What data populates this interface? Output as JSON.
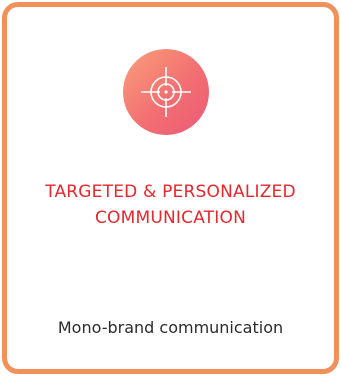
{
  "card": {
    "icon": "target-crosshair-icon",
    "title_line1": "TARGETED & PERSONALIZED",
    "title_line2": "COMMUNICATION",
    "subtitle": "Mono-brand communication"
  },
  "colors": {
    "border": "#f2905a",
    "icon_gradient_start": "#f9a07a",
    "icon_gradient_end": "#ec5a78",
    "title": "#e8262c",
    "subtitle": "#2b2b2b"
  }
}
